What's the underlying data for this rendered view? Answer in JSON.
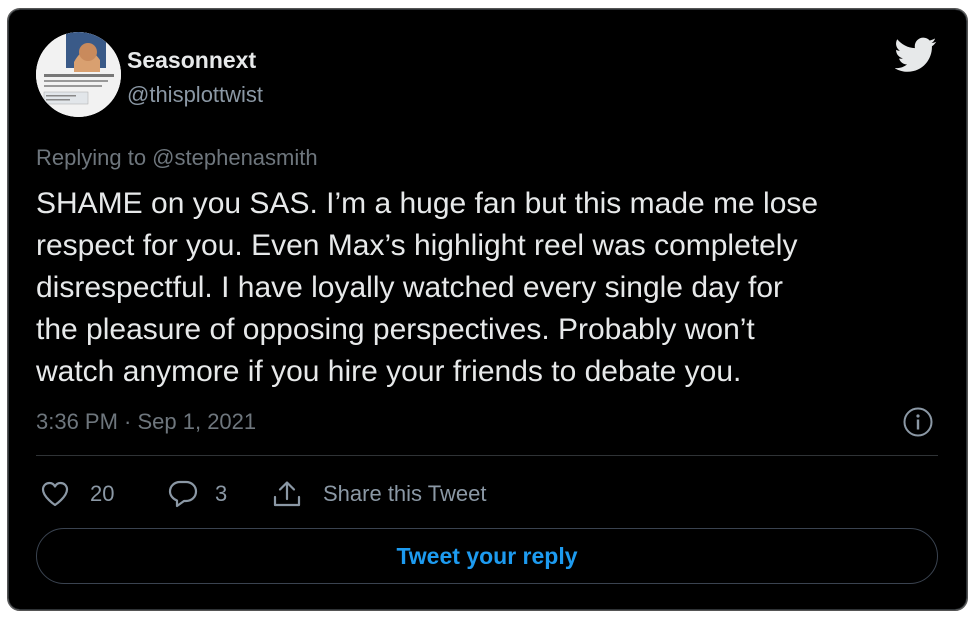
{
  "colors": {
    "background": "#000000",
    "text_primary": "#e7e9ea",
    "text_secondary": "#6e767d",
    "accent": "#1d9bf0",
    "divider": "#2f3336"
  },
  "author": {
    "display_name": "Seasonnext",
    "handle": "@thisplottwist",
    "avatar_icon": "avatar-image"
  },
  "tweet": {
    "reply_to": "Replying to @stephenasmith",
    "text_lines": [
      "SHAME on you SAS. I’m a huge fan but this made me lose",
      "respect for you. Even Max’s highlight reel was completely",
      "disrespectful. I have loyally watched every single day for",
      "the pleasure of opposing perspectives. Probably won’t",
      "watch anymore if you hire your friends to debate you."
    ],
    "timestamp": "3:36 PM · Sep 1, 2021"
  },
  "actions": {
    "likes_count": "20",
    "replies_count": "3",
    "share_label": "Share this Tweet"
  },
  "reply_button_label": "Tweet your reply",
  "icons": {
    "brand": "twitter-bird-icon",
    "info": "info-icon",
    "like": "heart-icon",
    "reply": "speech-bubble-icon",
    "share": "share-upload-icon"
  }
}
